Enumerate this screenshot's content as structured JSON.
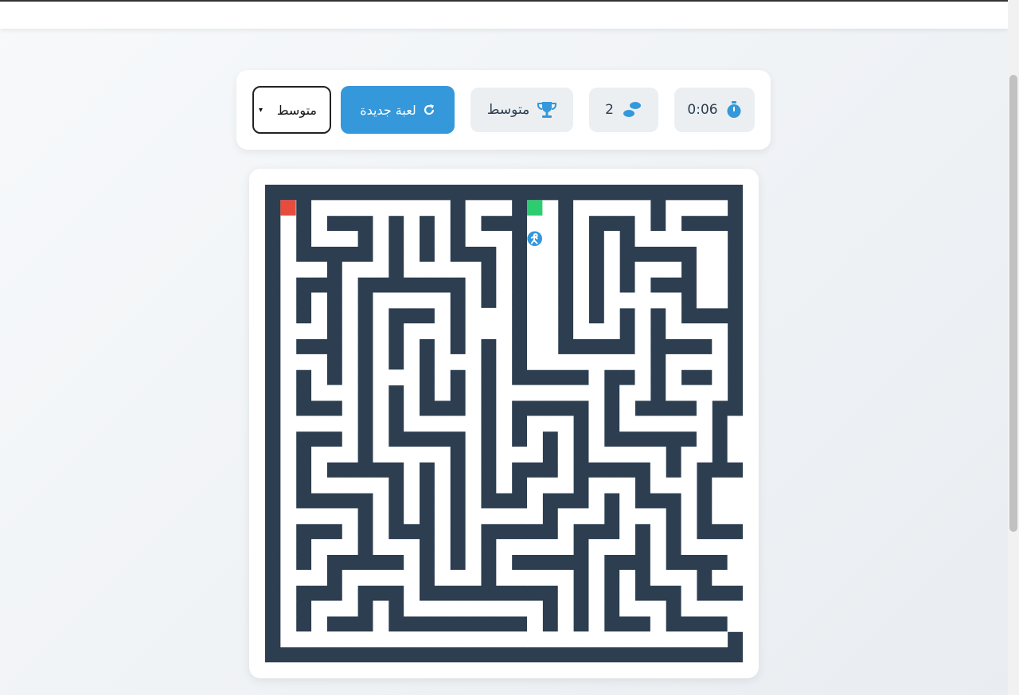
{
  "stats": {
    "timer_icon": "stopwatch-icon",
    "timer_value": "0:06",
    "moves_icon": "footsteps-icon",
    "moves_value": "2",
    "level_icon": "trophy-icon",
    "level_value": "متوسط"
  },
  "new_game": {
    "label": "لعبة جديدة",
    "icon": "refresh-icon"
  },
  "difficulty_select": {
    "selected": "متوسط"
  },
  "colors": {
    "wall": "#2c3e50",
    "path": "#ffffff",
    "start": "#2ecc71",
    "goal": "#e74c3c",
    "player": "#3498db",
    "accent": "#3498db"
  },
  "maze": {
    "rows": 31,
    "cols": 31,
    "grid": [
      "###############################",
      "#G#.........#...#..#.....#....#",
      "#.#.###.#.#.#.###..#.###.#.####",
      "#.#...#.#.#.#...#P.#.#.#......#",
      "#.#####.#.#.###.#..#.#.#####..#",
      "#...#...#.....#.#..#.#.#...#..#",
      "#.###.#######.#.#..#.#.#.###..#",
      "#.#.#.#.....#.#.#..#.#.....#..#",
      "#.#.#.#.###.#...#..#.#.#.#.####",
      "#...#.#.#...#...#..#...#.#....#",
      "#.###.#.#.#.#.#.#..#####.####.#",
      "#...#.#.#.#...#.#........#....#",
      "#.#.#.#...#.#.#.#####.##.#.##.#",
      "#.#...#.#.#.#.#.......#..#....#",
      "#.###.#.#.###.#.#####.#.####.##",
      "#.....#.#.....#.#...#.#......#.#",
      "#.###.#.#####.#.#.#.#.######.#.#",
      "#.#...#.....#.#...#.#.....#..#.#",
      "#.#.#####.#.#.#.###.#####.#.####",
      "#.#.....#.#.#.#.#...#...#...#..#",
      "#.#####.#.#.#.###.###.#.###.#..#",
      "#.....#.#.#.#.....#...#...#.#..#",
      "#.###.#.###.#.#####.###.#.#.####",
      "#.#...#...#.#.#.....#...#.#....#",
      "#.#.#####.#.#.#.#####.###.####.#",
      "#...#.....#...#.....#.#.#...#..#",
      "#.###.###.#########.#.#.###.####",
      "#.#...#.#.........#.#.#...#....#",
      "#.#.###.#########.#.#.###.####.#",
      "#.............................#",
      "###############################"
    ]
  }
}
